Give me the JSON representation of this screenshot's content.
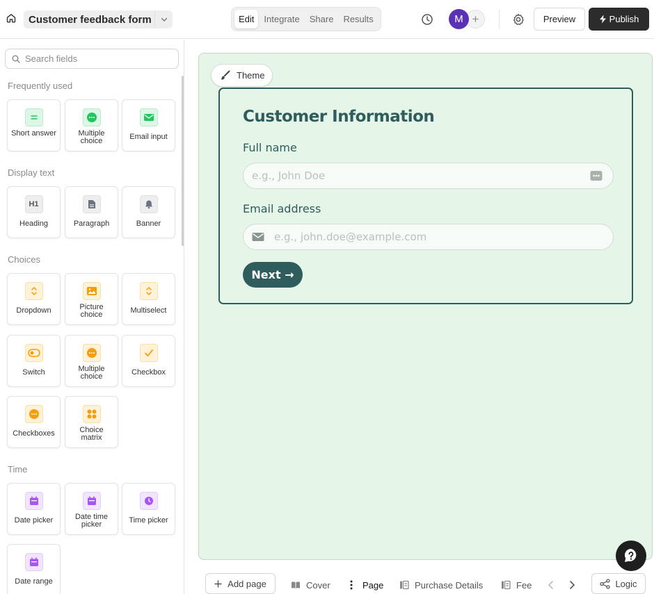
{
  "header": {
    "form_title": "Customer feedback form",
    "tabs": [
      {
        "label": "Edit",
        "active": true
      },
      {
        "label": "Integrate",
        "active": false
      },
      {
        "label": "Share",
        "active": false
      },
      {
        "label": "Results",
        "active": false
      }
    ],
    "avatar_initial": "M",
    "add_member": "+",
    "preview_label": "Preview",
    "publish_label": "Publish"
  },
  "sidebar": {
    "search_placeholder": "Search fields",
    "sections": [
      {
        "title": "Frequently used",
        "items": [
          {
            "label": "Short answer",
            "icon": "short-answer-icon",
            "color": "#22c55e"
          },
          {
            "label": "Multiple choice",
            "icon": "multiple-choice-icon",
            "color": "#22c55e"
          },
          {
            "label": "Email input",
            "icon": "email-icon",
            "color": "#22c55e"
          }
        ]
      },
      {
        "title": "Display text",
        "items": [
          {
            "label": "Heading",
            "icon": "heading-icon",
            "icon_text": "H1",
            "color": "#6b7280"
          },
          {
            "label": "Paragraph",
            "icon": "paragraph-icon",
            "color": "#6b7280"
          },
          {
            "label": "Banner",
            "icon": "bell-icon",
            "color": "#6b7280"
          }
        ]
      },
      {
        "title": "Choices",
        "items": [
          {
            "label": "Dropdown",
            "icon": "dropdown-icon",
            "color": "#f59e0b"
          },
          {
            "label": "Picture choice",
            "icon": "picture-icon",
            "color": "#f59e0b"
          },
          {
            "label": "Multiselect",
            "icon": "multiselect-icon",
            "color": "#f59e0b"
          },
          {
            "label": "Switch",
            "icon": "switch-icon",
            "color": "#f59e0b"
          },
          {
            "label": "Multiple choice",
            "icon": "multiple-choice-icon",
            "color": "#f59e0b"
          },
          {
            "label": "Checkbox",
            "icon": "checkbox-icon",
            "color": "#f59e0b"
          },
          {
            "label": "Checkboxes",
            "icon": "checkboxes-icon",
            "color": "#f59e0b"
          },
          {
            "label": "Choice matrix",
            "icon": "matrix-icon",
            "color": "#f59e0b"
          }
        ]
      },
      {
        "title": "Time",
        "items": [
          {
            "label": "Date picker",
            "icon": "calendar-icon",
            "color": "#a855f7"
          },
          {
            "label": "Date time picker",
            "icon": "calendar-icon",
            "color": "#a855f7"
          },
          {
            "label": "Time picker",
            "icon": "clock-icon",
            "color": "#a855f7"
          },
          {
            "label": "Date range",
            "icon": "calendar-icon",
            "color": "#a855f7"
          }
        ]
      }
    ]
  },
  "canvas": {
    "theme_label": "Theme",
    "form_heading": "Customer Information",
    "fields": [
      {
        "label": "Full name",
        "placeholder": "e.g., John Doe"
      },
      {
        "label": "Email address",
        "placeholder": "e.g., john.doe@example.com"
      }
    ],
    "next_label": "Next →",
    "accent_color": "#2f5d5d",
    "background_color": "#e5f6e8"
  },
  "bottom_bar": {
    "add_page_label": "Add page",
    "pages": [
      {
        "label": "Cover",
        "active": false
      },
      {
        "label": "Page",
        "active": true
      },
      {
        "label": "Purchase Details",
        "active": false
      },
      {
        "label": "Fee",
        "active": false
      }
    ],
    "logic_label": "Logic"
  }
}
